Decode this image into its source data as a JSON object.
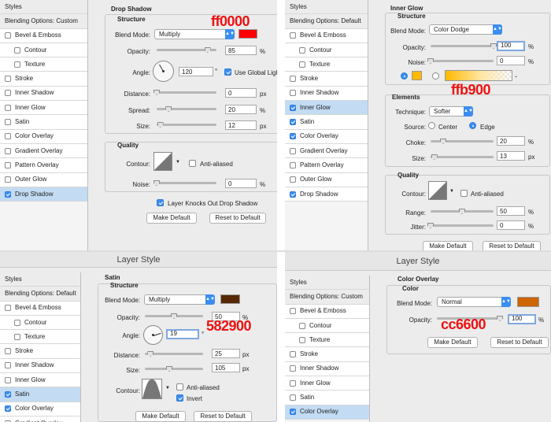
{
  "colors": {
    "drop_shadow": "#ff0000",
    "inner_glow": "#ffb900",
    "satin": "#582900",
    "color_overlay": "#cc6600",
    "annotation": "#ee1111",
    "accent": "#3b8ef0",
    "selected_row": "#c3dbf3"
  },
  "p1": {
    "sidebar": {
      "styles": "Styles",
      "blending": "Blending Options: Custom",
      "items": [
        {
          "label": "Bevel & Emboss",
          "checked": false,
          "sub": false,
          "sel": false
        },
        {
          "label": "Contour",
          "checked": false,
          "sub": true,
          "sel": false
        },
        {
          "label": "Texture",
          "checked": false,
          "sub": true,
          "sel": false
        },
        {
          "label": "Stroke",
          "checked": false,
          "sub": false,
          "sel": false
        },
        {
          "label": "Inner Shadow",
          "checked": false,
          "sub": false,
          "sel": false
        },
        {
          "label": "Inner Glow",
          "checked": false,
          "sub": false,
          "sel": false
        },
        {
          "label": "Satin",
          "checked": false,
          "sub": false,
          "sel": false
        },
        {
          "label": "Color Overlay",
          "checked": false,
          "sub": false,
          "sel": false
        },
        {
          "label": "Gradient Overlay",
          "checked": false,
          "sub": false,
          "sel": false
        },
        {
          "label": "Pattern Overlay",
          "checked": false,
          "sub": false,
          "sel": false
        },
        {
          "label": "Outer Glow",
          "checked": false,
          "sub": false,
          "sel": false
        },
        {
          "label": "Drop Shadow",
          "checked": true,
          "sub": false,
          "sel": true
        }
      ]
    },
    "title": "Drop Shadow",
    "structure": "Structure",
    "blend_mode_label": "Blend Mode:",
    "blend_mode": "Multiply",
    "opacity_label": "Opacity:",
    "opacity": "85",
    "angle_label": "Angle:",
    "angle": "120",
    "use_global_light": "Use Global Light",
    "distance_label": "Distance:",
    "distance": "0",
    "spread_label": "Spread:",
    "spread": "20",
    "size_label": "Size:",
    "size": "12",
    "quality": "Quality",
    "contour_label": "Contour:",
    "anti_aliased": "Anti-aliased",
    "noise_label": "Noise:",
    "noise": "0",
    "layer_knocks": "Layer Knocks Out Drop Shadow",
    "make_default": "Make Default",
    "reset_default": "Reset to Default",
    "annotation": "ff0000",
    "unit_pct": "%",
    "unit_px": "px",
    "unit_deg": "°"
  },
  "p2": {
    "sidebar": {
      "styles": "Styles",
      "blending": "Blending Options: Default",
      "items": [
        {
          "label": "Bevel & Emboss",
          "checked": false,
          "sub": false,
          "sel": false
        },
        {
          "label": "Contour",
          "checked": false,
          "sub": true,
          "sel": false
        },
        {
          "label": "Texture",
          "checked": false,
          "sub": true,
          "sel": false
        },
        {
          "label": "Stroke",
          "checked": false,
          "sub": false,
          "sel": false
        },
        {
          "label": "Inner Shadow",
          "checked": false,
          "sub": false,
          "sel": false
        },
        {
          "label": "Inner Glow",
          "checked": true,
          "sub": false,
          "sel": true
        },
        {
          "label": "Satin",
          "checked": true,
          "sub": false,
          "sel": false
        },
        {
          "label": "Color Overlay",
          "checked": true,
          "sub": false,
          "sel": false
        },
        {
          "label": "Gradient Overlay",
          "checked": false,
          "sub": false,
          "sel": false
        },
        {
          "label": "Pattern Overlay",
          "checked": false,
          "sub": false,
          "sel": false
        },
        {
          "label": "Outer Glow",
          "checked": false,
          "sub": false,
          "sel": false
        },
        {
          "label": "Drop Shadow",
          "checked": true,
          "sub": false,
          "sel": false
        }
      ]
    },
    "title": "Inner Glow",
    "structure": "Structure",
    "blend_mode_label": "Blend Mode:",
    "blend_mode": "Color Dodge",
    "opacity_label": "Opacity:",
    "opacity": "100",
    "noise_label": "Noise:",
    "noise": "0",
    "elements": "Elements",
    "technique_label": "Technique:",
    "technique": "Softer",
    "source_label": "Source:",
    "center": "Center",
    "edge": "Edge",
    "choke_label": "Choke:",
    "choke": "20",
    "size_label": "Size:",
    "size": "13",
    "quality": "Quality",
    "contour_label": "Contour:",
    "anti_aliased": "Anti-aliased",
    "range_label": "Range:",
    "range": "50",
    "jitter_label": "Jitter:",
    "jitter": "0",
    "make_default": "Make Default",
    "reset_default": "Reset to Default",
    "annotation": "ffb900",
    "unit_pct": "%",
    "unit_px": "px"
  },
  "p3": {
    "window_title": "Layer Style",
    "sidebar": {
      "styles": "Styles",
      "blending": "Blending Options: Default",
      "items": [
        {
          "label": "Bevel & Emboss",
          "checked": false,
          "sub": false,
          "sel": false
        },
        {
          "label": "Contour",
          "checked": false,
          "sub": true,
          "sel": false
        },
        {
          "label": "Texture",
          "checked": false,
          "sub": true,
          "sel": false
        },
        {
          "label": "Stroke",
          "checked": false,
          "sub": false,
          "sel": false
        },
        {
          "label": "Inner Shadow",
          "checked": false,
          "sub": false,
          "sel": false
        },
        {
          "label": "Inner Glow",
          "checked": false,
          "sub": false,
          "sel": false
        },
        {
          "label": "Satin",
          "checked": true,
          "sub": false,
          "sel": true
        },
        {
          "label": "Color Overlay",
          "checked": true,
          "sub": false,
          "sel": false
        },
        {
          "label": "Gradient Overlay",
          "checked": false,
          "sub": false,
          "sel": false
        }
      ]
    },
    "title": "Satin",
    "structure": "Structure",
    "blend_mode_label": "Blend Mode:",
    "blend_mode": "Multiply",
    "opacity_label": "Opacity:",
    "opacity": "50",
    "angle_label": "Angle:",
    "angle": "19",
    "distance_label": "Distance:",
    "distance": "25",
    "size_label": "Size:",
    "size": "105",
    "contour_label": "Contour:",
    "anti_aliased": "Anti-aliased",
    "invert": "Invert",
    "make_default": "Make Default",
    "reset_default": "Reset to Default",
    "annotation": "582900",
    "unit_pct": "%",
    "unit_px": "px",
    "unit_deg": "°"
  },
  "p4": {
    "window_title": "Layer Style",
    "sidebar": {
      "styles": "Styles",
      "blending": "Blending Options: Custom",
      "items": [
        {
          "label": "Bevel & Emboss",
          "checked": false,
          "sub": false,
          "sel": false
        },
        {
          "label": "Contour",
          "checked": false,
          "sub": true,
          "sel": false
        },
        {
          "label": "Texture",
          "checked": false,
          "sub": true,
          "sel": false
        },
        {
          "label": "Stroke",
          "checked": false,
          "sub": false,
          "sel": false
        },
        {
          "label": "Inner Shadow",
          "checked": false,
          "sub": false,
          "sel": false
        },
        {
          "label": "Inner Glow",
          "checked": false,
          "sub": false,
          "sel": false
        },
        {
          "label": "Satin",
          "checked": false,
          "sub": false,
          "sel": false
        },
        {
          "label": "Color Overlay",
          "checked": true,
          "sub": false,
          "sel": true
        }
      ]
    },
    "title": "Color Overlay",
    "color_group": "Color",
    "blend_mode_label": "Blend Mode:",
    "blend_mode": "Normal",
    "opacity_label": "Opacity:",
    "opacity": "100",
    "make_default": "Make Default",
    "reset_default": "Reset to Default",
    "annotation": "cc6600",
    "unit_pct": "%"
  },
  "sliders": {
    "p1_opacity": 0.85,
    "p1_distance": 0.0,
    "p1_spread": 0.2,
    "p1_size": 0.06,
    "p1_noise": 0.0,
    "p2_opacity": 1.0,
    "p2_noise": 0.0,
    "p2_choke": 0.2,
    "p2_size": 0.06,
    "p2_range": 0.5,
    "p2_jitter": 0.0,
    "p3_opacity": 0.5,
    "p3_distance": 0.1,
    "p3_size": 0.42,
    "p4_opacity": 1.0
  },
  "dials": {
    "p1_angle": 120,
    "p3_angle": 19
  }
}
